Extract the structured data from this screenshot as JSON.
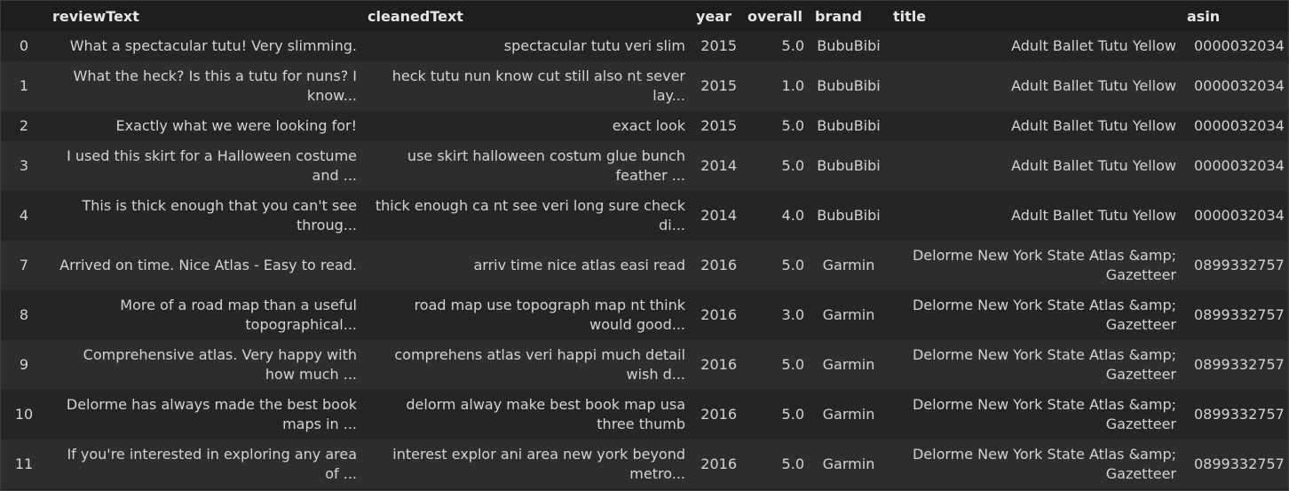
{
  "columns": {
    "index": "",
    "reviewText": "reviewText",
    "cleanedText": "cleanedText",
    "year": "year",
    "overall": "overall",
    "brand": "brand",
    "title": "title",
    "asin": "asin"
  },
  "rows": [
    {
      "index": "0",
      "reviewText": "What a spectacular tutu! Very slimming.",
      "cleanedText": "spectacular tutu veri slim",
      "year": "2015",
      "overall": "5.0",
      "brand": "BubuBibi",
      "title": "Adult Ballet Tutu Yellow",
      "asin": "0000032034"
    },
    {
      "index": "1",
      "reviewText": "What the heck? Is this a tutu for nuns? I know...",
      "cleanedText": "heck tutu nun know cut still also nt sever lay...",
      "year": "2015",
      "overall": "1.0",
      "brand": "BubuBibi",
      "title": "Adult Ballet Tutu Yellow",
      "asin": "0000032034"
    },
    {
      "index": "2",
      "reviewText": "Exactly what we were looking for!",
      "cleanedText": "exact look",
      "year": "2015",
      "overall": "5.0",
      "brand": "BubuBibi",
      "title": "Adult Ballet Tutu Yellow",
      "asin": "0000032034"
    },
    {
      "index": "3",
      "reviewText": "I used this skirt for a Halloween costume and ...",
      "cleanedText": "use skirt halloween costum glue bunch feather ...",
      "year": "2014",
      "overall": "5.0",
      "brand": "BubuBibi",
      "title": "Adult Ballet Tutu Yellow",
      "asin": "0000032034"
    },
    {
      "index": "4",
      "reviewText": "This is thick enough that you can't see throug...",
      "cleanedText": "thick enough ca nt see veri long sure check di...",
      "year": "2014",
      "overall": "4.0",
      "brand": "BubuBibi",
      "title": "Adult Ballet Tutu Yellow",
      "asin": "0000032034"
    },
    {
      "index": "7",
      "reviewText": "Arrived on time. Nice Atlas - Easy to read.",
      "cleanedText": "arriv time nice atlas easi read",
      "year": "2016",
      "overall": "5.0",
      "brand": "Garmin",
      "title": "Delorme New York State Atlas &amp; Gazetteer",
      "asin": "0899332757"
    },
    {
      "index": "8",
      "reviewText": "More of a road map than a useful topographical...",
      "cleanedText": "road map use topograph map nt think would good...",
      "year": "2016",
      "overall": "3.0",
      "brand": "Garmin",
      "title": "Delorme New York State Atlas &amp; Gazetteer",
      "asin": "0899332757"
    },
    {
      "index": "9",
      "reviewText": "Comprehensive atlas. Very happy with how much ...",
      "cleanedText": "comprehens atlas veri happi much detail wish d...",
      "year": "2016",
      "overall": "5.0",
      "brand": "Garmin",
      "title": "Delorme New York State Atlas &amp; Gazetteer",
      "asin": "0899332757"
    },
    {
      "index": "10",
      "reviewText": "Delorme has always made the best book maps in ...",
      "cleanedText": "delorm alway make best book map usa three thumb",
      "year": "2016",
      "overall": "5.0",
      "brand": "Garmin",
      "title": "Delorme New York State Atlas &amp; Gazetteer",
      "asin": "0899332757"
    },
    {
      "index": "11",
      "reviewText": "If you're interested in exploring any area of ...",
      "cleanedText": "interest explor ani area new york beyond metro...",
      "year": "2016",
      "overall": "5.0",
      "brand": "Garmin",
      "title": "Delorme New York State Atlas &amp; Gazetteer",
      "asin": "0899332757"
    }
  ]
}
